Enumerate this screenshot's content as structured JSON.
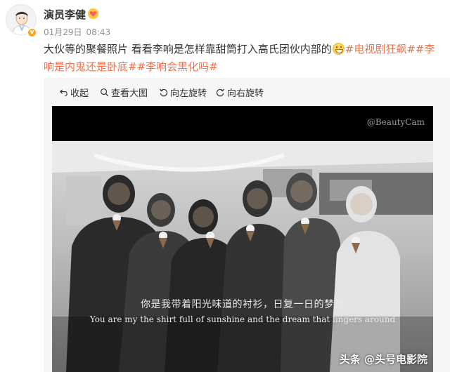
{
  "post": {
    "author": "演员李健",
    "verified_badge": "v",
    "date": "01月29日",
    "time": "08:43",
    "text_main": "大伙等的聚餐照片 看看李响是怎样靠甜筒打入高氏团伙内部的",
    "tags": [
      "#电视剧狂飙#",
      "#李响是内鬼还是卧底#",
      "#李响会黑化吗#"
    ],
    "icons": {
      "avatar": "doctor-avatar",
      "vip": "vip-heart-icon",
      "emoji": "grin-emoji"
    }
  },
  "toolbar": {
    "collapse": "收起",
    "view_large": "查看大图",
    "rotate_left": "向左旋转",
    "rotate_right": "向右旋转"
  },
  "photo": {
    "watermark": "@BeautyCam",
    "subtitle_cn": "你是我带着阳光味道的衬衫，日复一日的梦想",
    "subtitle_en": "You are my the shirt full of sunshine and the dream that lingers around",
    "source_watermark": "头条 @头号电影院"
  },
  "colors": {
    "tag": "#eb7350",
    "meta": "#939393",
    "panel": "#f6f6f6"
  }
}
